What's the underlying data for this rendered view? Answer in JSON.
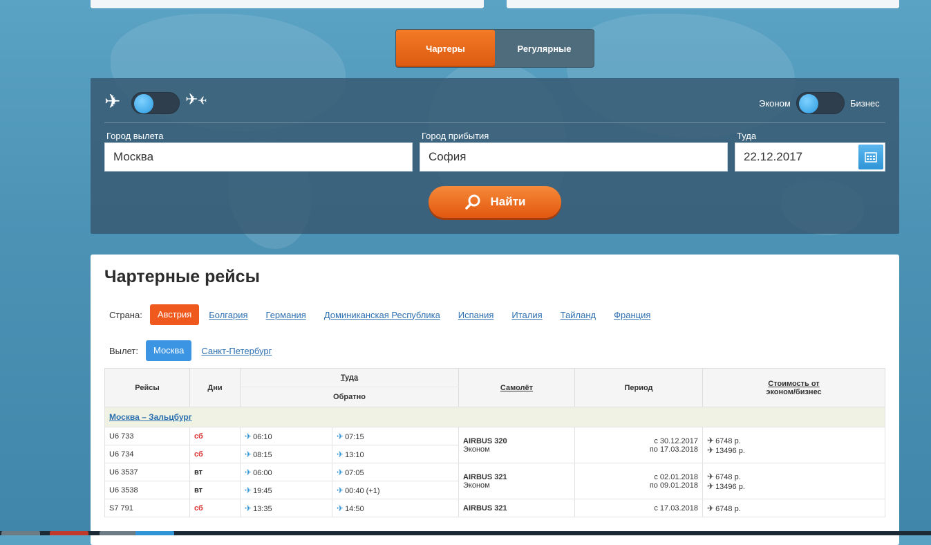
{
  "mode_tabs": [
    "Чартеры",
    "Регулярные"
  ],
  "search": {
    "class_economy": "Эконом",
    "class_business": "Бизнес",
    "from_label": "Город вылета",
    "from_value": "Москва",
    "to_label": "Город прибытия",
    "to_value": "София",
    "date_label": "Туда",
    "date_value": "22.12.2017",
    "find_label": "Найти"
  },
  "content": {
    "title": "Чартерные рейсы",
    "country_label": "Страна:",
    "countries": [
      "Австрия",
      "Болгария",
      "Германия",
      "Доминиканская Республика",
      "Испания",
      "Италия",
      "Тайланд",
      "Франция"
    ],
    "departure_label": "Вылет:",
    "departures": [
      "Москва",
      "Санкт-Петербург"
    ]
  },
  "table": {
    "headers": {
      "flights": "Рейсы",
      "days": "Дни",
      "to": "Туда",
      "back": "Обратно",
      "aircraft": "Самолёт",
      "period": "Период",
      "price_line1": "Стоимость от",
      "price_line2": "эконом/бизнес"
    },
    "route": "Москва – Зальцбург",
    "rows": [
      {
        "f1": "U6 733",
        "d1": "сб",
        "dep1": "06:10",
        "arr1": "07:15",
        "f2": "U6 734",
        "d2": "сб",
        "dep2": "08:15",
        "arr2": "13:10",
        "aircraft": "AIRBUS 320",
        "class": "Эконом",
        "p1": "с 30.12.2017",
        "p2": "по 17.03.2018",
        "price1": "6748 р.",
        "price2": "13496 р."
      },
      {
        "f1": "U6 3537",
        "d1": "вт",
        "dep1": "06:00",
        "arr1": "07:05",
        "f2": "U6 3538",
        "d2": "вт",
        "dep2": "19:45",
        "arr2": "00:40 (+1)",
        "aircraft": "AIRBUS 321",
        "class": "Эконом",
        "p1": "с 02.01.2018",
        "p2": "по 09.01.2018",
        "price1": "6748 р.",
        "price2": "13496 р."
      },
      {
        "f1": "S7 791",
        "d1": "сб",
        "dep1": "13:35",
        "arr1": "14:50",
        "aircraft": "AIRBUS 321",
        "p1": "с 17.03.2018",
        "price1": "6748 р."
      }
    ]
  }
}
